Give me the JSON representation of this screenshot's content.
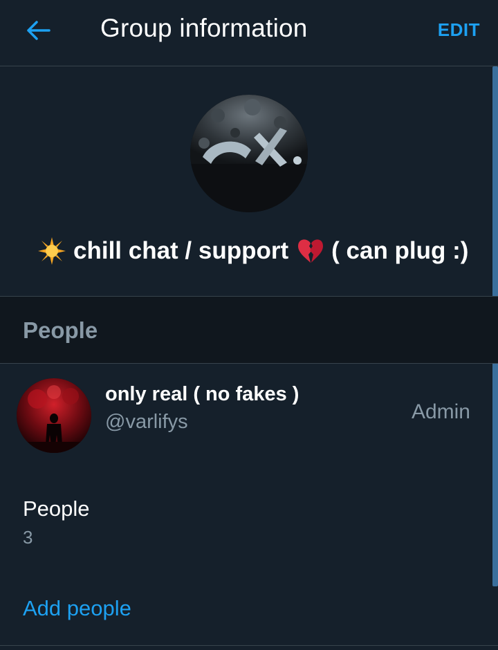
{
  "header": {
    "title": "Group information",
    "edit_label": "EDIT",
    "back_icon": "arrow-left-icon"
  },
  "group": {
    "avatar_icon": "group-avatar-image",
    "name_parts": {
      "emoji_start": "sun-emoji",
      "text_a": "chill chat / support",
      "emoji_mid": "broken-heart-emoji",
      "text_b": "( can plug :)"
    }
  },
  "people_section": {
    "heading": "People",
    "members": [
      {
        "name": "only real ( no fakes )",
        "handle": "@varlifys",
        "role": "Admin"
      }
    ],
    "count_label": "People",
    "count_value": "3",
    "add_label": "Add people"
  },
  "colors": {
    "background": "#15202b",
    "section_background": "#10171e",
    "divider": "#38444d",
    "accent": "#1da1f2",
    "secondary_text": "#8899a6",
    "primary_text": "#ffffff"
  }
}
